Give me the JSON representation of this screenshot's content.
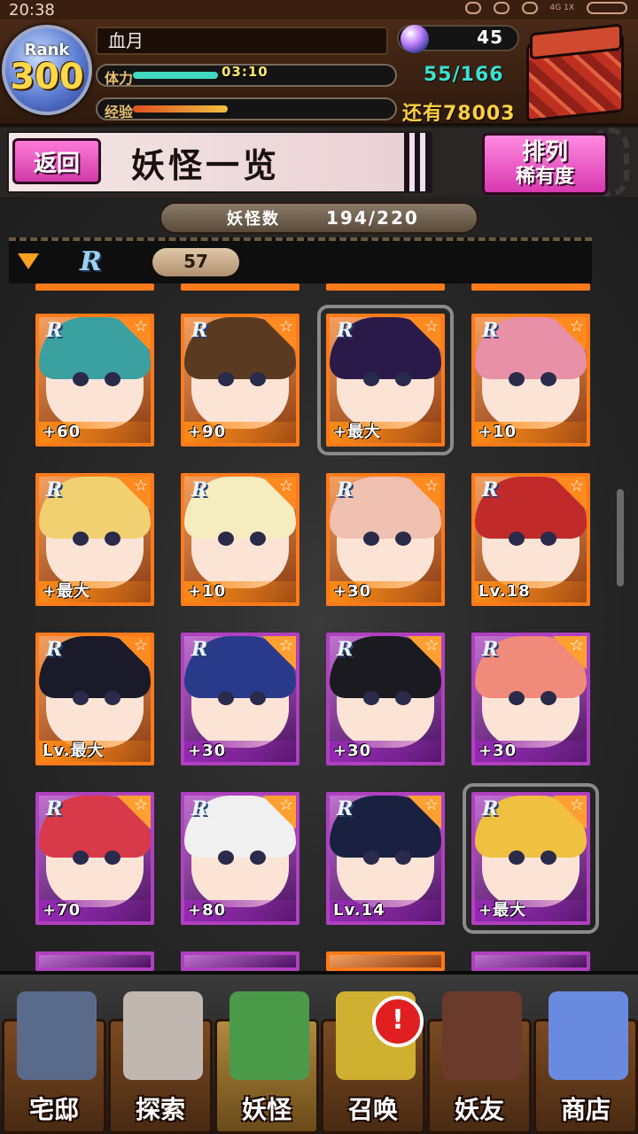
{
  "status_bar": {
    "time": "20:38",
    "network": "4G 1X"
  },
  "header": {
    "rank_label": "Rank",
    "rank_value": "300",
    "player_name": "血月",
    "stamina_label": "体力",
    "stamina_timer": "03:10",
    "stamina_fraction": 0.33,
    "stamina_count": "55/166",
    "exp_label": "经验",
    "exp_fraction": 0.37,
    "exp_remaining": "还有78003",
    "gems": "45"
  },
  "title_bar": {
    "back_label": "返回",
    "title": "妖怪一览",
    "sort_label_1": "排列",
    "sort_label_2": "稀有度"
  },
  "list": {
    "count_label": "妖怪数",
    "count_value": "194/220",
    "group_rarity": "R",
    "group_count": "57",
    "cards": [
      {
        "rarity": "R",
        "badge": "+60",
        "frame": "orange",
        "hair": "#3aa0a0"
      },
      {
        "rarity": "R",
        "badge": "+90",
        "frame": "orange",
        "hair": "#5a3a20"
      },
      {
        "rarity": "R",
        "badge": "+最大",
        "frame": "orange",
        "hair": "#2a1a4a",
        "selected": true
      },
      {
        "rarity": "R",
        "badge": "+10",
        "frame": "orange",
        "hair": "#e890a8"
      },
      {
        "rarity": "R",
        "badge": "+最大",
        "frame": "orange",
        "hair": "#f0d070"
      },
      {
        "rarity": "R",
        "badge": "+10",
        "frame": "orange",
        "hair": "#f5ecc0"
      },
      {
        "rarity": "R",
        "badge": "+30",
        "frame": "orange",
        "hair": "#f0c0b0"
      },
      {
        "rarity": "R",
        "badge": "Lv.18",
        "frame": "orange",
        "hair": "#c02a2a"
      },
      {
        "rarity": "R",
        "badge": "Lv.最大",
        "frame": "orange",
        "hair": "#1a1a2a"
      },
      {
        "rarity": "R",
        "badge": "+30",
        "frame": "purple",
        "hair": "#2a3a8a"
      },
      {
        "rarity": "R",
        "badge": "+30",
        "frame": "purple",
        "hair": "#1a1a20"
      },
      {
        "rarity": "R",
        "badge": "+30",
        "frame": "purple",
        "hair": "#f08a7a"
      },
      {
        "rarity": "R",
        "badge": "+70",
        "frame": "purple",
        "hair": "#d83a4a"
      },
      {
        "rarity": "R",
        "badge": "+80",
        "frame": "purple",
        "hair": "#f0f0f0"
      },
      {
        "rarity": "R",
        "badge": "Lv.14",
        "frame": "purple",
        "hair": "#1a2040"
      },
      {
        "rarity": "R",
        "badge": "+最大",
        "frame": "purple",
        "hair": "#f0c040",
        "selected": true
      }
    ]
  },
  "bottom_nav": [
    {
      "label": "宅邸",
      "icon": "mansion-icon",
      "color": "#5a6a8a"
    },
    {
      "label": "探索",
      "icon": "magnifier-icon",
      "color": "#c0b8b0"
    },
    {
      "label": "妖怪",
      "icon": "scroll-icon",
      "color": "#4a9a4a",
      "active": true
    },
    {
      "label": "召唤",
      "icon": "summon-icon",
      "color": "#d0b030"
    },
    {
      "label": "妖友",
      "icon": "friend-icon",
      "color": "#6a3a2a"
    },
    {
      "label": "商店",
      "icon": "orb-icon",
      "color": "#6a8ae0"
    }
  ],
  "alert_symbol": "!"
}
